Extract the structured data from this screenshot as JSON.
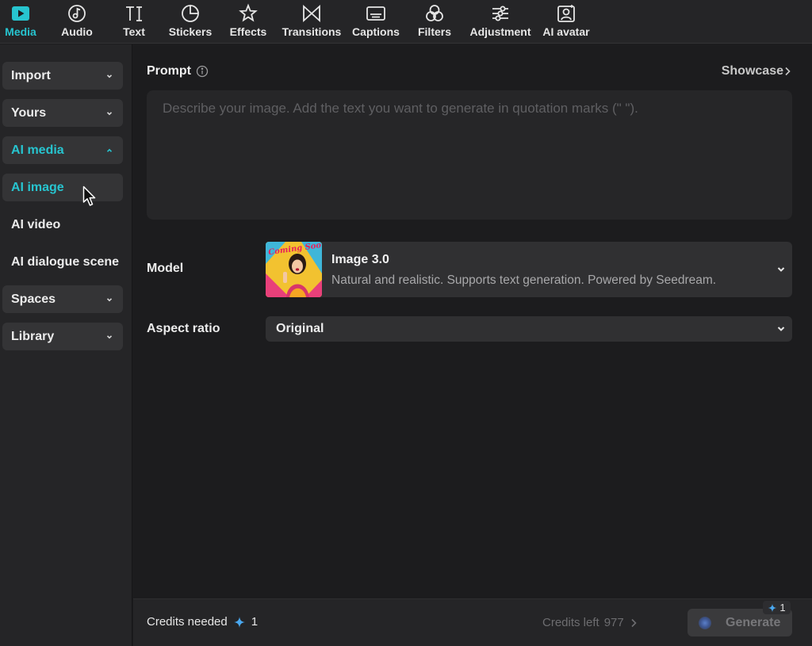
{
  "toolbar": {
    "tabs": [
      {
        "label": "Media",
        "icon": "media-play-icon",
        "active": true
      },
      {
        "label": "Audio",
        "icon": "audio-note-icon"
      },
      {
        "label": "Text",
        "icon": "text-ti-icon"
      },
      {
        "label": "Stickers",
        "icon": "sticker-icon"
      },
      {
        "label": "Effects",
        "icon": "effects-star-icon"
      },
      {
        "label": "Transitions",
        "icon": "transitions-bowtie-icon"
      },
      {
        "label": "Captions",
        "icon": "captions-icon"
      },
      {
        "label": "Filters",
        "icon": "filters-icon"
      },
      {
        "label": "Adjustment",
        "icon": "adjustment-sliders-icon"
      },
      {
        "label": "AI avatar",
        "icon": "ai-avatar-icon"
      }
    ],
    "accent_color": "#27c4cf"
  },
  "sidebar": {
    "items": [
      {
        "label": "Import"
      },
      {
        "label": "Yours"
      },
      {
        "label": "AI media"
      },
      {
        "label": "AI image"
      },
      {
        "label": "AI video"
      },
      {
        "label": "AI dialogue scene"
      },
      {
        "label": "Spaces"
      },
      {
        "label": "Library"
      }
    ]
  },
  "prompt": {
    "title": "Prompt",
    "placeholder": "Describe your image. Add the text you want to generate in quotation marks (\" \").",
    "value": "",
    "showcase": "Showcase"
  },
  "model": {
    "label": "Model",
    "name": "Image 3.0",
    "description": "Natural and realistic. Supports text generation. Powered by Seedream.",
    "thumbnail_text": "Coming Soon!"
  },
  "aspect": {
    "label": "Aspect ratio",
    "value": "Original"
  },
  "footer": {
    "credits_needed_label": "Credits needed",
    "credits_needed": "1",
    "credits_left_label": "Credits left",
    "credits_left": "977",
    "generate": "Generate",
    "badge": "1"
  }
}
